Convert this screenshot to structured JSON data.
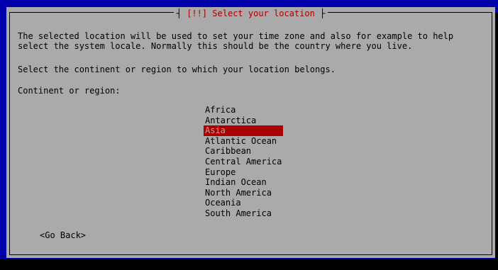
{
  "dialog": {
    "title": "[!!] Select your location",
    "description_line1": "The selected location will be used to set your time zone and also for example to help",
    "description_line2": "select the system locale. Normally this should be the country where you live.",
    "prompt": "Select the continent or region to which your location belongs.",
    "list_label": "Continent or region:",
    "regions": [
      "Africa",
      "Antarctica",
      "Asia",
      "Atlantic Ocean",
      "Caribbean",
      "Central America",
      "Europe",
      "Indian Ocean",
      "North America",
      "Oceania",
      "South America"
    ],
    "selected_region": "Asia",
    "go_back_label": "<Go Back>"
  },
  "colors": {
    "screen_background": "#0000aa",
    "dialog_background": "#aaaaaa",
    "title_text": "#aa0000",
    "selection_background": "#aa0000",
    "text": "#000000"
  }
}
